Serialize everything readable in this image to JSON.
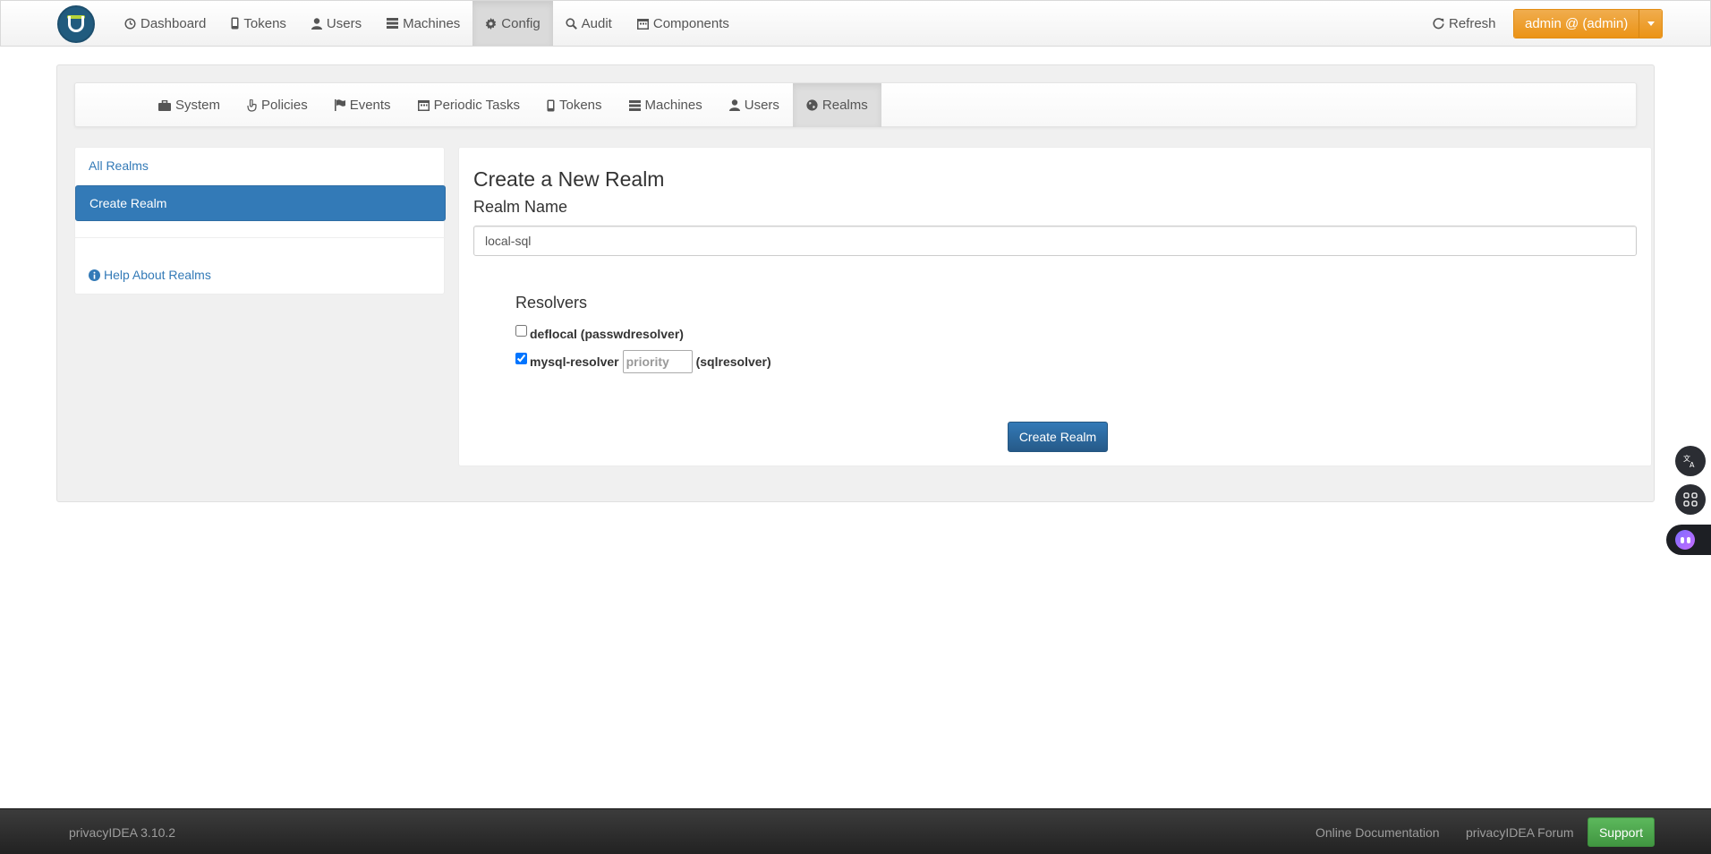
{
  "topnav": {
    "items": [
      {
        "label": "Dashboard",
        "icon": "dashboard-icon"
      },
      {
        "label": "Tokens",
        "icon": "phone-icon"
      },
      {
        "label": "Users",
        "icon": "user-icon"
      },
      {
        "label": "Machines",
        "icon": "tasks-icon"
      },
      {
        "label": "Config",
        "icon": "cog-icon",
        "active": true
      },
      {
        "label": "Audit",
        "icon": "search-icon"
      },
      {
        "label": "Components",
        "icon": "calendar-icon"
      }
    ],
    "refresh_label": "Refresh",
    "user_menu_label": "admin @ (admin)"
  },
  "subnav": {
    "items": [
      {
        "label": "System",
        "icon": "briefcase-icon"
      },
      {
        "label": "Policies",
        "icon": "hand-icon"
      },
      {
        "label": "Events",
        "icon": "flag-icon"
      },
      {
        "label": "Periodic Tasks",
        "icon": "calendar-icon"
      },
      {
        "label": "Tokens",
        "icon": "phone-icon"
      },
      {
        "label": "Machines",
        "icon": "tasks-icon"
      },
      {
        "label": "Users",
        "icon": "user-icon"
      },
      {
        "label": "Realms",
        "icon": "globe-icon",
        "active": true
      }
    ]
  },
  "sidebar": {
    "all_realms": "All Realms",
    "create_realm": "Create Realm",
    "help": "Help About Realms"
  },
  "form": {
    "title": "Create a New Realm",
    "realm_name_label": "Realm Name",
    "realm_name_value": "local-sql",
    "resolvers_title": "Resolvers",
    "resolvers": [
      {
        "name": "deflocal",
        "type": "(passwdresolver)",
        "checked": false
      },
      {
        "name": "mysql-resolver",
        "type": "(sqlresolver)",
        "checked": true,
        "priority_placeholder": "priority"
      }
    ],
    "submit_label": "Create Realm"
  },
  "footer": {
    "version": "privacyIDEA 3.10.2",
    "docs_link": "Online Documentation",
    "forum_link": "privacyIDEA Forum",
    "support_label": "Support"
  },
  "colors": {
    "primary": "#337ab7",
    "warning": "#f0ad4e",
    "success": "#5cb85c",
    "footer_bg": "#2b2b2b"
  }
}
